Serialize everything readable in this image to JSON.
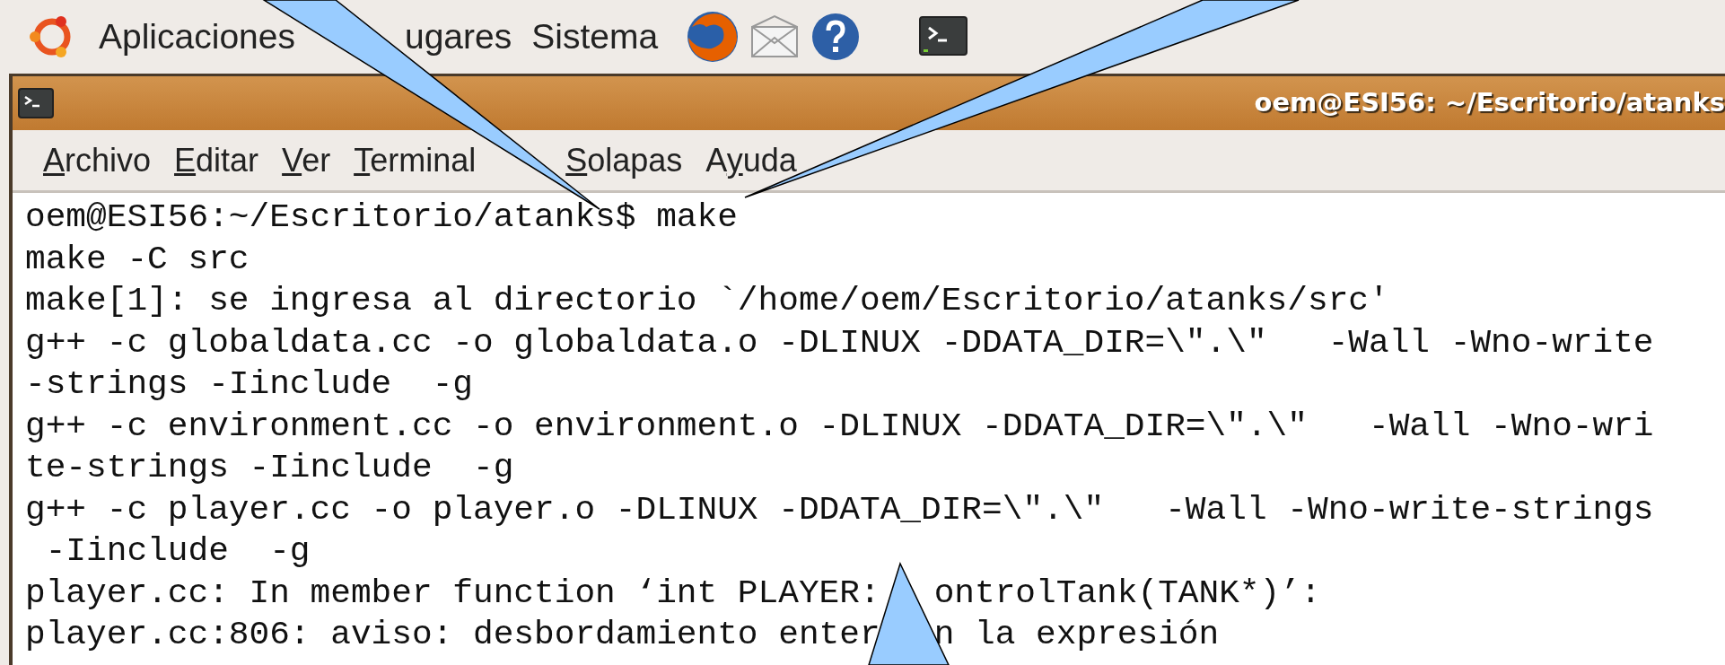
{
  "panel": {
    "menus": [
      "Aplicaciones",
      "ugares",
      "Sistema"
    ]
  },
  "window": {
    "title": "oem@ESI56: ~/Escritorio/atanks"
  },
  "menubar": [
    {
      "mnemonic": "A",
      "label_end": "rchivo"
    },
    {
      "mnemonic": "E",
      "label_end": "ditar"
    },
    {
      "mnemonic": "V",
      "label_end": "er"
    },
    {
      "mnemonic": "T",
      "label_end": "erminal"
    },
    {
      "mnemonic": "S",
      "label_end": "olapas"
    },
    {
      "label_start": "A",
      "mnemonic": "y",
      "label_end": "uda"
    }
  ],
  "terminal": {
    "lines": [
      "oem@ESI56:~/Escritorio/atanks$ make",
      "make -C src",
      "make[1]: se ingresa al directorio `/home/oem/Escritorio/atanks/src'",
      "g++ -c globaldata.cc -o globaldata.o -DLINUX -DDATA_DIR=\\\".\\\"   -Wall -Wno-write",
      "-strings -Iinclude  -g",
      "g++ -c environment.cc -o environment.o -DLINUX -DDATA_DIR=\\\".\\\"   -Wall -Wno-wri",
      "te-strings -Iinclude  -g",
      "g++ -c player.cc -o player.o -DLINUX -DDATA_DIR=\\\".\\\"   -Wall -Wno-write-strings",
      " -Iinclude  -g",
      [
        "player.cc: In member function ‘int PLAYER:",
        "ontrolTank(TANK*)’:"
      ],
      [
        "player.cc:806: aviso: desbordamiento enter",
        "n la expresión"
      ]
    ]
  }
}
